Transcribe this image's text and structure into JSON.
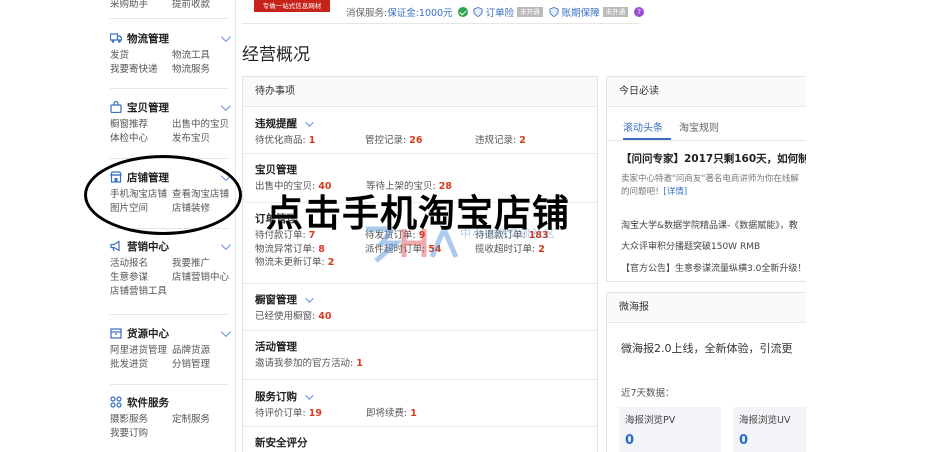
{
  "sidebar": {
    "top_row": [
      "采购助手",
      "提前收款"
    ],
    "sections": [
      {
        "title": "物流管理",
        "icon": "truck-icon",
        "rows": [
          [
            "发货",
            "物流工具"
          ],
          [
            "我要寄快递",
            "物流服务"
          ]
        ]
      },
      {
        "title": "宝贝管理",
        "icon": "bag-icon",
        "rows": [
          [
            "橱窗推荐",
            "出售中的宝贝"
          ],
          [
            "体检中心",
            "发布宝贝"
          ]
        ]
      },
      {
        "title": "店铺管理",
        "icon": "store-icon",
        "rows": [
          [
            "手机淘宝店铺",
            "查看淘宝店铺"
          ],
          [
            "图片空间",
            "店铺装修"
          ]
        ]
      },
      {
        "title": "营销中心",
        "icon": "megaphone-icon",
        "rows": [
          [
            "活动报名",
            "我要推广"
          ],
          [
            "生意参谋",
            "店铺营销中心"
          ],
          [
            "店铺营销工具",
            ""
          ]
        ]
      },
      {
        "title": "货源中心",
        "icon": "box-icon",
        "rows": [
          [
            "阿里进货管理",
            "品牌货源"
          ],
          [
            "批发进货",
            "分销管理"
          ]
        ]
      },
      {
        "title": "软件服务",
        "icon": "grid-icon",
        "rows": [
          [
            "摄影服务",
            "定制服务"
          ],
          [
            "我要订购",
            ""
          ]
        ]
      }
    ]
  },
  "topbar": {
    "ad_text": "专做一站式信息网材",
    "deposit_label": "消保服务:",
    "deposit_link": "保证金:1000元",
    "order_insurance": "订单险",
    "order_tag": "未开通",
    "account_insurance": "账期保障",
    "account_tag": "未开通",
    "help": "?"
  },
  "page_title": "经营概况",
  "todo": {
    "header": "待办事项",
    "groups": [
      {
        "title": "违规提醒",
        "chevron": true,
        "rows": [
          [
            [
              "待优化商品: ",
              "1"
            ],
            [
              "管控记录: ",
              "26"
            ],
            [
              "违规记录: ",
              "2"
            ]
          ]
        ]
      },
      {
        "title": "宝贝管理",
        "chevron": false,
        "rows": [
          [
            [
              "出售中的宝贝: ",
              "40"
            ],
            [
              "等待上架的宝贝: ",
              "28"
            ]
          ]
        ]
      },
      {
        "title": "订单管理",
        "chevron": false,
        "rows": [
          [
            [
              "待付款订单: ",
              "7"
            ],
            [
              "待发货订单: ",
              "9"
            ],
            [
              "待退款订单: ",
              "183"
            ]
          ],
          [
            [
              "物流异常订单: ",
              "8"
            ],
            [
              "派件超时订单: ",
              "54"
            ],
            [
              "揽收超时订单: ",
              "2"
            ]
          ],
          [
            [
              "物流未更新订单: ",
              "2"
            ]
          ]
        ]
      },
      {
        "title": "橱窗管理",
        "chevron": true,
        "rows": [
          [
            [
              "已经使用橱窗: ",
              "40"
            ]
          ]
        ]
      },
      {
        "title": "活动管理",
        "chevron": false,
        "rows": [
          [
            [
              "邀请我参加的官方活动: ",
              "1"
            ]
          ]
        ]
      },
      {
        "title": "服务订购",
        "chevron": true,
        "rows": [
          [
            [
              "待评价订单: ",
              "19"
            ],
            [
              "即将续费: ",
              "1"
            ]
          ]
        ]
      },
      {
        "title": "新安全评分",
        "chevron": false,
        "rows": []
      }
    ]
  },
  "today": {
    "header": "今日必读",
    "tabs": [
      "滚动头条",
      "淘宝规则"
    ],
    "headline": "【问问专家】2017只剩160天，如何制",
    "desc_line1": "卖家中心特邀\"问商友\"著名电商讲师为你在线解",
    "desc_line2": "的问题吧！",
    "desc_link": "[详情]",
    "items": [
      "淘宝大学&数据学院精品课-《数据赋能》，教",
      "大众评审积分播题突破150W RMB",
      "【官方公告】生意参谋流量纵横3.0全新升级！"
    ]
  },
  "weibao": {
    "header": "微海报",
    "title": "微海报2.0上线，全新体验，引流更",
    "sub": "近7天数据：",
    "stats": [
      {
        "label": "海报浏览PV",
        "value": "0"
      },
      {
        "label": "海报浏览UV",
        "value": "0"
      }
    ]
  },
  "overlay": {
    "caption": "点击手机淘宝店铺",
    "watermark": "中小电商交流社区"
  }
}
